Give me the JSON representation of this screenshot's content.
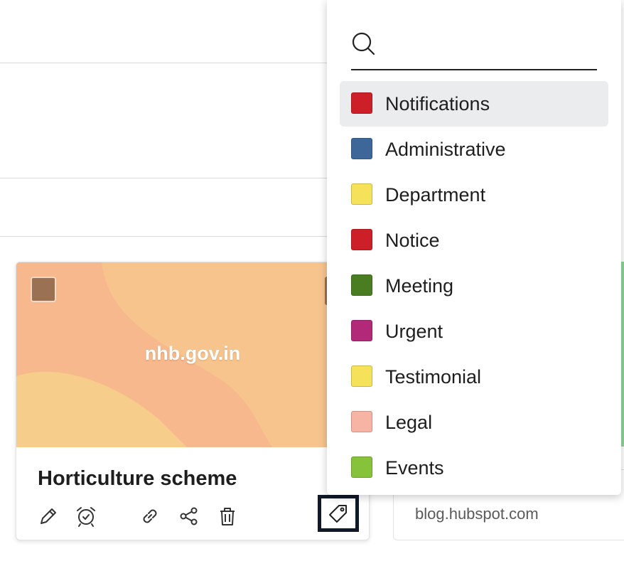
{
  "card": {
    "domain": "nhb.gov.in",
    "title": "Horticulture scheme",
    "actions": [
      {
        "icon": "pencil-icon",
        "name": "edit-button"
      },
      {
        "icon": "alarm-clock-icon",
        "name": "reminder-button"
      },
      {
        "icon": "link-icon",
        "name": "copy-link-button"
      },
      {
        "icon": "share-icon",
        "name": "share-button"
      },
      {
        "icon": "trash-icon",
        "name": "delete-button"
      }
    ],
    "tag_button_icon": "tag-icon"
  },
  "card2": {
    "domain": "blog.hubspot.com"
  },
  "dropdown": {
    "search_icon": "search-icon",
    "search_value": "",
    "active_index": 0,
    "items": [
      {
        "label": "Notifications",
        "color": "#cc1f27"
      },
      {
        "label": "Administrative",
        "color": "#3e6799"
      },
      {
        "label": "Department",
        "color": "#f5e15a"
      },
      {
        "label": "Notice",
        "color": "#cc1f27"
      },
      {
        "label": "Meeting",
        "color": "#4a7d22"
      },
      {
        "label": "Urgent",
        "color": "#b3297a"
      },
      {
        "label": "Testimonial",
        "color": "#f5e15a"
      },
      {
        "label": "Legal",
        "color": "#f7b4a4"
      },
      {
        "label": "Events",
        "color": "#86c33b"
      }
    ]
  }
}
